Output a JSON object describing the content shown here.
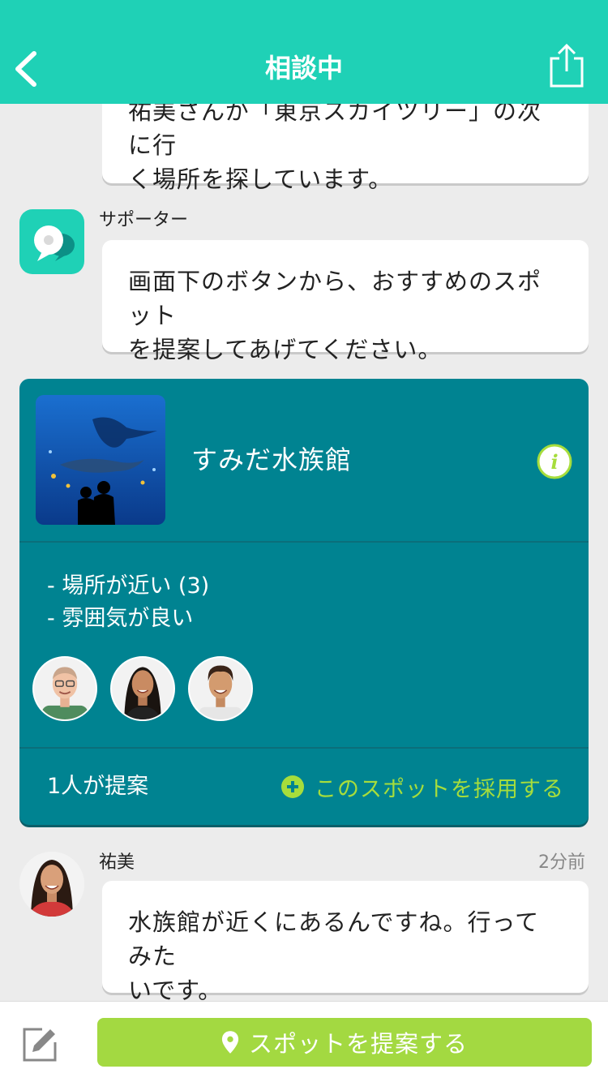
{
  "header": {
    "title": "相談中",
    "back_icon": "chevron-left-icon",
    "share_icon": "share-icon",
    "background": "#1fd1b6"
  },
  "messages": [
    {
      "text_line1": "祐美さんが「東京スカイツリー」の次に行",
      "text_line2": "く場所を探しています。"
    },
    {
      "sender": "サポーター",
      "text_line1": "画面下のボタンから、おすすめのスポット",
      "text_line2": "を提案してあげてください。"
    },
    {
      "sender": "祐美",
      "time": "2分前",
      "text_line1": "水族館が近くにあるんですね。行ってみた",
      "text_line2": "いです。"
    }
  ],
  "spot_card": {
    "name": "すみだ水族館",
    "reasons": [
      "- 場所が近い (3)",
      "- 雰囲気が良い"
    ],
    "count_text": "1人が提案",
    "adopt_label": "このスポットを採用する",
    "background": "#008391",
    "accent": "#a6dd3c"
  },
  "footer": {
    "propose_label": "スポットを提案する",
    "propose_color": "#a3d941",
    "edit_icon": "compose-icon",
    "pin_icon": "map-pin-icon"
  }
}
